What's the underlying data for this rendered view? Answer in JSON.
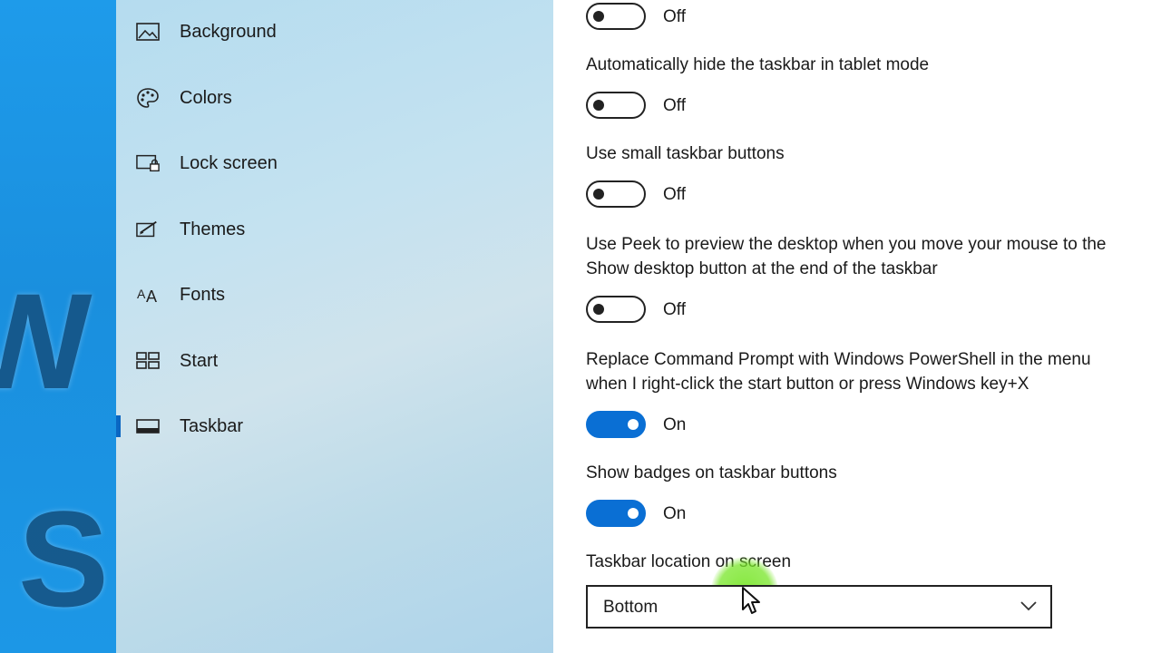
{
  "wallpaper": {
    "text_line1": "W",
    "text_line2": "S"
  },
  "sidebar": {
    "items": [
      {
        "label": "Background",
        "icon": "picture-icon"
      },
      {
        "label": "Colors",
        "icon": "palette-icon"
      },
      {
        "label": "Lock screen",
        "icon": "lock-screen-icon"
      },
      {
        "label": "Themes",
        "icon": "themes-icon"
      },
      {
        "label": "Fonts",
        "icon": "fonts-icon"
      },
      {
        "label": "Start",
        "icon": "start-icon"
      },
      {
        "label": "Taskbar",
        "icon": "taskbar-icon",
        "selected": true
      }
    ]
  },
  "settings": {
    "top_toggle": {
      "state": "Off",
      "on": false
    },
    "auto_hide_tablet": {
      "label": "Automatically hide the taskbar in tablet mode",
      "state": "Off",
      "on": false
    },
    "small_buttons": {
      "label": "Use small taskbar buttons",
      "state": "Off",
      "on": false
    },
    "peek": {
      "label_line1": "Use Peek to preview the desktop when you move your mouse to the",
      "label_line2": "Show desktop button at the end of the taskbar",
      "state": "Off",
      "on": false
    },
    "powershell": {
      "label_line1": "Replace Command Prompt with Windows PowerShell in the menu",
      "label_line2": "when I right-click the start button or press Windows key+X",
      "state": "On",
      "on": true
    },
    "badges": {
      "label": "Show badges on taskbar buttons",
      "state": "On",
      "on": true
    },
    "location": {
      "label": "Taskbar location on screen",
      "value": "Bottom"
    }
  },
  "colors": {
    "accent": "#0a6fd4",
    "selection_bar": "#0a66c2"
  }
}
